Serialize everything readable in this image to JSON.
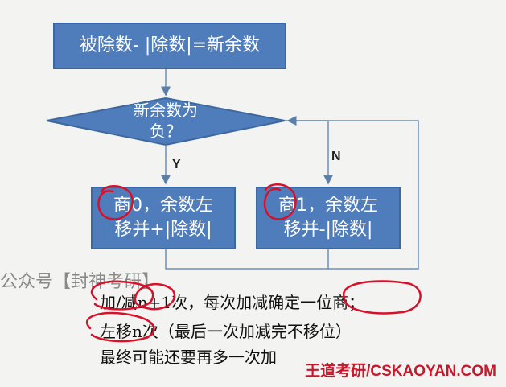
{
  "flowchart": {
    "start_box": "被除数- |除数|=新余数",
    "decision_line1": "新余数为",
    "decision_line2": "负？",
    "yes_label": "Y",
    "no_label": "N",
    "yes_box_line1": "商0，余数左",
    "yes_box_line2": "移并+|除数|",
    "no_box_line1": "商1，余数左",
    "no_box_line2": "移并-|除数|"
  },
  "notes": {
    "line1": "加/减n+1次，每次加减确定一位商；",
    "line2": "左移n次（最后一次加减完不移位）",
    "line3": "最终可能还要再多一次加"
  },
  "watermark": "公众号【封神考研】",
  "brand": "王道考研/CSKAOYAN.COM",
  "colors": {
    "box_fill": "#4f7dbc",
    "annotation_ink": "#d8102a",
    "brand_red": "#c8172b"
  }
}
